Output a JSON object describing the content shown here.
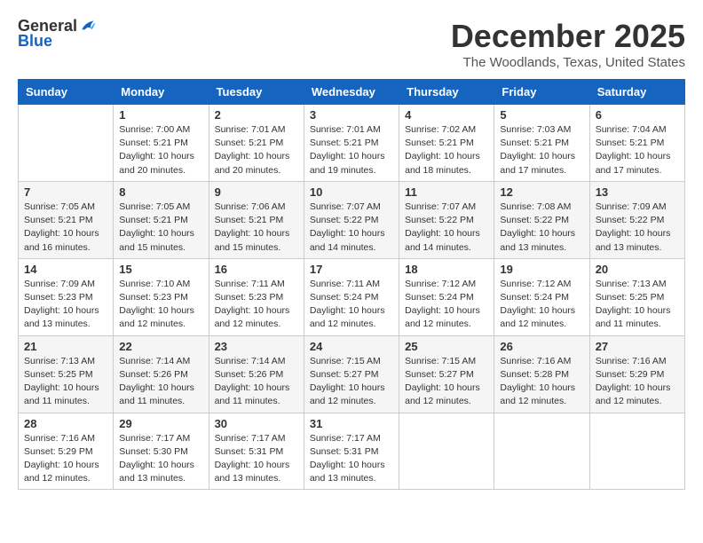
{
  "header": {
    "logo_line1": "General",
    "logo_line2": "Blue",
    "month": "December 2025",
    "location": "The Woodlands, Texas, United States"
  },
  "weekdays": [
    "Sunday",
    "Monday",
    "Tuesday",
    "Wednesday",
    "Thursday",
    "Friday",
    "Saturday"
  ],
  "weeks": [
    [
      {
        "day": "",
        "info": ""
      },
      {
        "day": "1",
        "info": "Sunrise: 7:00 AM\nSunset: 5:21 PM\nDaylight: 10 hours\nand 20 minutes."
      },
      {
        "day": "2",
        "info": "Sunrise: 7:01 AM\nSunset: 5:21 PM\nDaylight: 10 hours\nand 20 minutes."
      },
      {
        "day": "3",
        "info": "Sunrise: 7:01 AM\nSunset: 5:21 PM\nDaylight: 10 hours\nand 19 minutes."
      },
      {
        "day": "4",
        "info": "Sunrise: 7:02 AM\nSunset: 5:21 PM\nDaylight: 10 hours\nand 18 minutes."
      },
      {
        "day": "5",
        "info": "Sunrise: 7:03 AM\nSunset: 5:21 PM\nDaylight: 10 hours\nand 17 minutes."
      },
      {
        "day": "6",
        "info": "Sunrise: 7:04 AM\nSunset: 5:21 PM\nDaylight: 10 hours\nand 17 minutes."
      }
    ],
    [
      {
        "day": "7",
        "info": "Sunrise: 7:05 AM\nSunset: 5:21 PM\nDaylight: 10 hours\nand 16 minutes."
      },
      {
        "day": "8",
        "info": "Sunrise: 7:05 AM\nSunset: 5:21 PM\nDaylight: 10 hours\nand 15 minutes."
      },
      {
        "day": "9",
        "info": "Sunrise: 7:06 AM\nSunset: 5:21 PM\nDaylight: 10 hours\nand 15 minutes."
      },
      {
        "day": "10",
        "info": "Sunrise: 7:07 AM\nSunset: 5:22 PM\nDaylight: 10 hours\nand 14 minutes."
      },
      {
        "day": "11",
        "info": "Sunrise: 7:07 AM\nSunset: 5:22 PM\nDaylight: 10 hours\nand 14 minutes."
      },
      {
        "day": "12",
        "info": "Sunrise: 7:08 AM\nSunset: 5:22 PM\nDaylight: 10 hours\nand 13 minutes."
      },
      {
        "day": "13",
        "info": "Sunrise: 7:09 AM\nSunset: 5:22 PM\nDaylight: 10 hours\nand 13 minutes."
      }
    ],
    [
      {
        "day": "14",
        "info": "Sunrise: 7:09 AM\nSunset: 5:23 PM\nDaylight: 10 hours\nand 13 minutes."
      },
      {
        "day": "15",
        "info": "Sunrise: 7:10 AM\nSunset: 5:23 PM\nDaylight: 10 hours\nand 12 minutes."
      },
      {
        "day": "16",
        "info": "Sunrise: 7:11 AM\nSunset: 5:23 PM\nDaylight: 10 hours\nand 12 minutes."
      },
      {
        "day": "17",
        "info": "Sunrise: 7:11 AM\nSunset: 5:24 PM\nDaylight: 10 hours\nand 12 minutes."
      },
      {
        "day": "18",
        "info": "Sunrise: 7:12 AM\nSunset: 5:24 PM\nDaylight: 10 hours\nand 12 minutes."
      },
      {
        "day": "19",
        "info": "Sunrise: 7:12 AM\nSunset: 5:24 PM\nDaylight: 10 hours\nand 12 minutes."
      },
      {
        "day": "20",
        "info": "Sunrise: 7:13 AM\nSunset: 5:25 PM\nDaylight: 10 hours\nand 11 minutes."
      }
    ],
    [
      {
        "day": "21",
        "info": "Sunrise: 7:13 AM\nSunset: 5:25 PM\nDaylight: 10 hours\nand 11 minutes."
      },
      {
        "day": "22",
        "info": "Sunrise: 7:14 AM\nSunset: 5:26 PM\nDaylight: 10 hours\nand 11 minutes."
      },
      {
        "day": "23",
        "info": "Sunrise: 7:14 AM\nSunset: 5:26 PM\nDaylight: 10 hours\nand 11 minutes."
      },
      {
        "day": "24",
        "info": "Sunrise: 7:15 AM\nSunset: 5:27 PM\nDaylight: 10 hours\nand 12 minutes."
      },
      {
        "day": "25",
        "info": "Sunrise: 7:15 AM\nSunset: 5:27 PM\nDaylight: 10 hours\nand 12 minutes."
      },
      {
        "day": "26",
        "info": "Sunrise: 7:16 AM\nSunset: 5:28 PM\nDaylight: 10 hours\nand 12 minutes."
      },
      {
        "day": "27",
        "info": "Sunrise: 7:16 AM\nSunset: 5:29 PM\nDaylight: 10 hours\nand 12 minutes."
      }
    ],
    [
      {
        "day": "28",
        "info": "Sunrise: 7:16 AM\nSunset: 5:29 PM\nDaylight: 10 hours\nand 12 minutes."
      },
      {
        "day": "29",
        "info": "Sunrise: 7:17 AM\nSunset: 5:30 PM\nDaylight: 10 hours\nand 13 minutes."
      },
      {
        "day": "30",
        "info": "Sunrise: 7:17 AM\nSunset: 5:31 PM\nDaylight: 10 hours\nand 13 minutes."
      },
      {
        "day": "31",
        "info": "Sunrise: 7:17 AM\nSunset: 5:31 PM\nDaylight: 10 hours\nand 13 minutes."
      },
      {
        "day": "",
        "info": ""
      },
      {
        "day": "",
        "info": ""
      },
      {
        "day": "",
        "info": ""
      }
    ]
  ]
}
